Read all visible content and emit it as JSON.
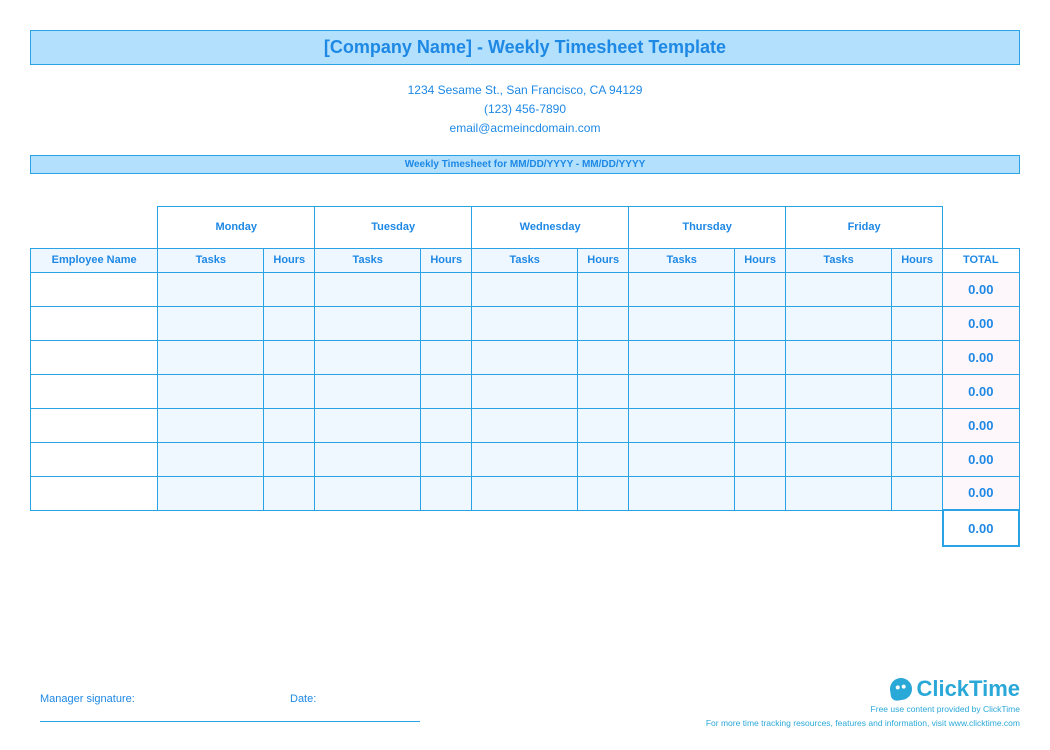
{
  "header": {
    "title": "[Company Name] - Weekly Timesheet Template",
    "address": "1234 Sesame St.,  San Francisco, CA 94129",
    "phone": "(123) 456-7890",
    "email": "email@acmeincdomain.com",
    "period": "Weekly Timesheet for MM/DD/YYYY - MM/DD/YYYY"
  },
  "columns": {
    "employee": "Employee Name",
    "days": [
      "Monday",
      "Tuesday",
      "Wednesday",
      "Thursday",
      "Friday"
    ],
    "tasks": "Tasks",
    "hours": "Hours",
    "total": "TOTAL"
  },
  "rows": [
    {
      "total": "0.00"
    },
    {
      "total": "0.00"
    },
    {
      "total": "0.00"
    },
    {
      "total": "0.00"
    },
    {
      "total": "0.00"
    },
    {
      "total": "0.00"
    },
    {
      "total": "0.00"
    }
  ],
  "grand_total": "0.00",
  "signature": {
    "manager": "Manager signature:",
    "date": "Date:"
  },
  "footer": {
    "brand": "ClickTime",
    "line1": "Free use content provided by ClickTime",
    "line2": "For more time tracking resources, features and information, visit www.clicktime.com"
  }
}
